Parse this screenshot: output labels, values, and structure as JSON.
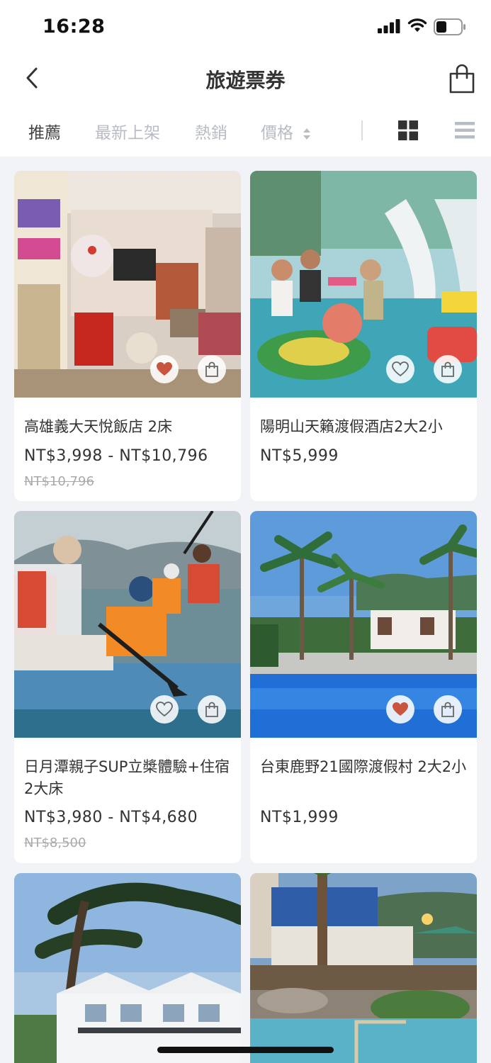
{
  "status_bar": {
    "time": "16:28"
  },
  "nav": {
    "title": "旅遊票券"
  },
  "sort": {
    "tabs": [
      "推薦",
      "最新上架",
      "熱銷",
      "價格"
    ],
    "active": "推薦"
  },
  "products": [
    {
      "name": "高雄義大天悅飯店 2床",
      "price": "NT$3,998 - NT$10,796",
      "original_price": "NT$10,796",
      "favorited": true
    },
    {
      "name": "陽明山天籟渡假酒店2大2小",
      "price": "NT$5,999",
      "original_price": "",
      "favorited": false
    },
    {
      "name": "日月潭親子SUP立槳體驗+住宿2大床",
      "price": "NT$3,980 - NT$4,680",
      "original_price": "NT$8,500",
      "favorited": false
    },
    {
      "name": "台東鹿野21國際渡假村 2大2小",
      "price": "NT$1,999",
      "original_price": "",
      "favorited": true
    }
  ],
  "colors": {
    "heart_active": "#c9553f",
    "accent_text": "#333333",
    "muted_text": "#b8bcc4"
  }
}
